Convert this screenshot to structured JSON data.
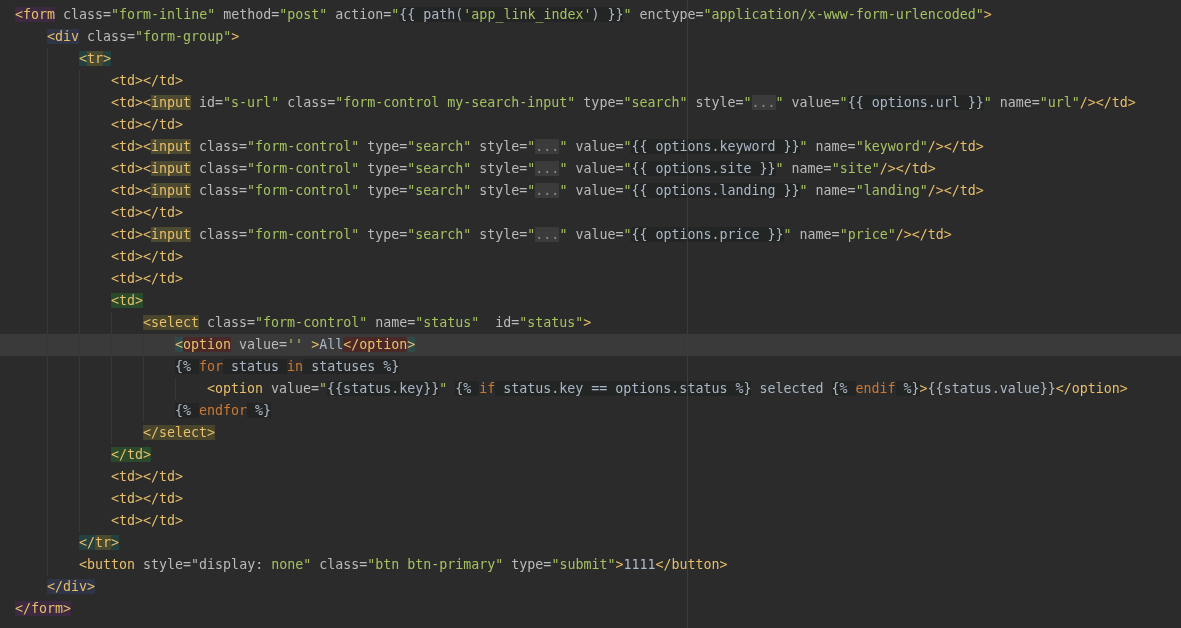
{
  "lines": [
    {
      "tokens": [
        {
          "text": "<form",
          "kind": "tag",
          "color": "#3d2a40"
        },
        {
          "text": " class=",
          "kind": "attr"
        },
        {
          "text": "\"form-inline\"",
          "kind": "str"
        },
        {
          "text": " method=",
          "kind": "attr"
        },
        {
          "text": "\"post\"",
          "kind": "str"
        },
        {
          "text": " action=",
          "kind": "attr"
        },
        {
          "text": "\"",
          "kind": "str"
        },
        {
          "text": "{{ path(",
          "kind": "tpl"
        },
        {
          "text": "'app_link_index'",
          "kind": "tplstr"
        },
        {
          "text": ") }}",
          "kind": "tpl"
        },
        {
          "text": "\"",
          "kind": "str"
        },
        {
          "text": " enctype=",
          "kind": "attr"
        },
        {
          "text": "\"application/x-www-form-urlencoded\"",
          "kind": "str"
        },
        {
          "text": ">",
          "kind": "tag"
        }
      ],
      "children": [
        {
          "tokens": [
            {
              "text": "<div",
              "kind": "tag",
              "color": "#2f3447"
            },
            {
              "text": " class=",
              "kind": "attr"
            },
            {
              "text": "\"form-group\"",
              "kind": "str"
            },
            {
              "text": ">",
              "kind": "tag"
            }
          ],
          "children": [
            {
              "tokens": [
                {
                  "text": "<",
                  "kind": "tag",
                  "color": "#24403f"
                },
                {
                  "text": "tr",
                  "kind": "tag",
                  "color": "#4a4a30"
                },
                {
                  "text": ">",
                  "kind": "tag",
                  "color": "#24403f"
                }
              ],
              "children": [
                {
                  "tokens": [
                    {
                      "text": "<td></td>",
                      "kind": "tag"
                    }
                  ]
                },
                {
                  "tokens": [
                    {
                      "text": "<td><",
                      "kind": "tag"
                    },
                    {
                      "text": "input",
                      "kind": "tag",
                      "color": "#4d4a32"
                    },
                    {
                      "text": " id=",
                      "kind": "attr"
                    },
                    {
                      "text": "\"s-url\"",
                      "kind": "str"
                    },
                    {
                      "text": " class=",
                      "kind": "attr"
                    },
                    {
                      "text": "\"form-control my-search-input\"",
                      "kind": "str"
                    },
                    {
                      "text": " type=",
                      "kind": "attr"
                    },
                    {
                      "text": "\"search\"",
                      "kind": "str"
                    },
                    {
                      "text": " style=",
                      "kind": "attr"
                    },
                    {
                      "text": "\"",
                      "kind": "str"
                    },
                    {
                      "text": "...",
                      "kind": "fold"
                    },
                    {
                      "text": "\"",
                      "kind": "str"
                    },
                    {
                      "text": " value=",
                      "kind": "attr"
                    },
                    {
                      "text": "\"",
                      "kind": "str"
                    },
                    {
                      "text": "{{ options.url }}",
                      "kind": "tpl"
                    },
                    {
                      "text": "\"",
                      "kind": "str"
                    },
                    {
                      "text": " name=",
                      "kind": "attr"
                    },
                    {
                      "text": "\"url\"",
                      "kind": "str"
                    },
                    {
                      "text": "/></td>",
                      "kind": "tag"
                    }
                  ]
                },
                {
                  "tokens": [
                    {
                      "text": "<td></td>",
                      "kind": "tag"
                    }
                  ]
                },
                {
                  "tokens": [
                    {
                      "text": "<td><",
                      "kind": "tag"
                    },
                    {
                      "text": "input",
                      "kind": "tag",
                      "color": "#4d4a32"
                    },
                    {
                      "text": " class=",
                      "kind": "attr"
                    },
                    {
                      "text": "\"form-control\"",
                      "kind": "str"
                    },
                    {
                      "text": " type=",
                      "kind": "attr"
                    },
                    {
                      "text": "\"search\"",
                      "kind": "str"
                    },
                    {
                      "text": " style=",
                      "kind": "attr"
                    },
                    {
                      "text": "\"",
                      "kind": "str"
                    },
                    {
                      "text": "...",
                      "kind": "fold"
                    },
                    {
                      "text": "\"",
                      "kind": "str"
                    },
                    {
                      "text": " value=",
                      "kind": "attr"
                    },
                    {
                      "text": "\"",
                      "kind": "str"
                    },
                    {
                      "text": "{{ options.keyword }}",
                      "kind": "tpl"
                    },
                    {
                      "text": "\"",
                      "kind": "str"
                    },
                    {
                      "text": " name=",
                      "kind": "attr"
                    },
                    {
                      "text": "\"keyword\"",
                      "kind": "str"
                    },
                    {
                      "text": "/></td>",
                      "kind": "tag"
                    }
                  ]
                },
                {
                  "tokens": [
                    {
                      "text": "<td><",
                      "kind": "tag"
                    },
                    {
                      "text": "input",
                      "kind": "tag",
                      "color": "#4d4a32"
                    },
                    {
                      "text": " class=",
                      "kind": "attr"
                    },
                    {
                      "text": "\"form-control\"",
                      "kind": "str"
                    },
                    {
                      "text": " type=",
                      "kind": "attr"
                    },
                    {
                      "text": "\"search\"",
                      "kind": "str"
                    },
                    {
                      "text": " style=",
                      "kind": "attr"
                    },
                    {
                      "text": "\"",
                      "kind": "str"
                    },
                    {
                      "text": "...",
                      "kind": "fold"
                    },
                    {
                      "text": "\"",
                      "kind": "str"
                    },
                    {
                      "text": " value=",
                      "kind": "attr"
                    },
                    {
                      "text": "\"",
                      "kind": "str"
                    },
                    {
                      "text": "{{ options.site }}",
                      "kind": "tpl"
                    },
                    {
                      "text": "\"",
                      "kind": "str"
                    },
                    {
                      "text": " name=",
                      "kind": "attr"
                    },
                    {
                      "text": "\"site\"",
                      "kind": "str"
                    },
                    {
                      "text": "/></td>",
                      "kind": "tag"
                    }
                  ]
                },
                {
                  "tokens": [
                    {
                      "text": "<td><",
                      "kind": "tag"
                    },
                    {
                      "text": "input",
                      "kind": "tag",
                      "color": "#4d4a32"
                    },
                    {
                      "text": " class=",
                      "kind": "attr"
                    },
                    {
                      "text": "\"form-control\"",
                      "kind": "str"
                    },
                    {
                      "text": " type=",
                      "kind": "attr"
                    },
                    {
                      "text": "\"search\"",
                      "kind": "str"
                    },
                    {
                      "text": " style=",
                      "kind": "attr"
                    },
                    {
                      "text": "\"",
                      "kind": "str"
                    },
                    {
                      "text": "...",
                      "kind": "fold"
                    },
                    {
                      "text": "\"",
                      "kind": "str"
                    },
                    {
                      "text": " value=",
                      "kind": "attr"
                    },
                    {
                      "text": "\"",
                      "kind": "str"
                    },
                    {
                      "text": "{{ options.landing }}",
                      "kind": "tpl"
                    },
                    {
                      "text": "\"",
                      "kind": "str"
                    },
                    {
                      "text": " name=",
                      "kind": "attr"
                    },
                    {
                      "text": "\"landing\"",
                      "kind": "str"
                    },
                    {
                      "text": "/></td>",
                      "kind": "tag"
                    }
                  ]
                },
                {
                  "tokens": [
                    {
                      "text": "<td></td>",
                      "kind": "tag"
                    }
                  ]
                },
                {
                  "tokens": [
                    {
                      "text": "<td><",
                      "kind": "tag"
                    },
                    {
                      "text": "input",
                      "kind": "tag",
                      "color": "#4d4a32"
                    },
                    {
                      "text": " class=",
                      "kind": "attr"
                    },
                    {
                      "text": "\"form-control\"",
                      "kind": "str"
                    },
                    {
                      "text": " type=",
                      "kind": "attr"
                    },
                    {
                      "text": "\"search\"",
                      "kind": "str"
                    },
                    {
                      "text": " style=",
                      "kind": "attr"
                    },
                    {
                      "text": "\"",
                      "kind": "str"
                    },
                    {
                      "text": "...",
                      "kind": "fold"
                    },
                    {
                      "text": "\"",
                      "kind": "str"
                    },
                    {
                      "text": " value=",
                      "kind": "attr"
                    },
                    {
                      "text": "\"",
                      "kind": "str"
                    },
                    {
                      "text": "{{ options.price }}",
                      "kind": "tpl"
                    },
                    {
                      "text": "\"",
                      "kind": "str"
                    },
                    {
                      "text": " name=",
                      "kind": "attr"
                    },
                    {
                      "text": "\"price\"",
                      "kind": "str"
                    },
                    {
                      "text": "/></td>",
                      "kind": "tag"
                    }
                  ]
                },
                {
                  "tokens": [
                    {
                      "text": "<td></td>",
                      "kind": "tag"
                    }
                  ]
                },
                {
                  "tokens": [
                    {
                      "text": "<td></td>",
                      "kind": "tag"
                    }
                  ]
                },
                {
                  "tokens": [
                    {
                      "text": "<td>",
                      "kind": "tag",
                      "color": "#2b4a2b"
                    }
                  ],
                  "children": [
                    {
                      "tokens": [
                        {
                          "text": "<select",
                          "kind": "tag",
                          "color": "#48452c"
                        },
                        {
                          "text": " class=",
                          "kind": "attr"
                        },
                        {
                          "text": "\"form-control\"",
                          "kind": "str"
                        },
                        {
                          "text": " name=",
                          "kind": "attr"
                        },
                        {
                          "text": "\"status\"",
                          "kind": "str"
                        },
                        {
                          "text": "  id=",
                          "kind": "attr"
                        },
                        {
                          "text": "\"status\"",
                          "kind": "str"
                        },
                        {
                          "text": ">",
                          "kind": "tag"
                        }
                      ],
                      "children": [
                        {
                          "current": true,
                          "tokens": [
                            {
                              "text": "<",
                              "kind": "tag",
                              "color": "#2f4a48"
                            },
                            {
                              "text": "option",
                              "kind": "tag",
                              "color": "#4a2828"
                            },
                            {
                              "text": " value=",
                              "kind": "attr"
                            },
                            {
                              "text": "''",
                              "kind": "str"
                            },
                            {
                              "text": " >",
                              "kind": "tag"
                            },
                            {
                              "text": "All",
                              "kind": "text"
                            },
                            {
                              "text": "</option",
                              "kind": "tag",
                              "color": "#4a2828"
                            },
                            {
                              "text": ">",
                              "kind": "tag",
                              "color": "#2f4a48"
                            }
                          ]
                        },
                        {
                          "tokens": [
                            {
                              "text": "{% ",
                              "kind": "tpl"
                            },
                            {
                              "text": "for",
                              "kind": "kw"
                            },
                            {
                              "text": " status ",
                              "kind": "tpl"
                            },
                            {
                              "text": "in",
                              "kind": "kw"
                            },
                            {
                              "text": " statuses %}",
                              "kind": "tpl"
                            }
                          ],
                          "children": [
                            {
                              "tokens": [
                                {
                                  "text": "<option",
                                  "kind": "tag"
                                },
                                {
                                  "text": " value=",
                                  "kind": "attr"
                                },
                                {
                                  "text": "\"",
                                  "kind": "str"
                                },
                                {
                                  "text": "{{status.key}}",
                                  "kind": "tpl"
                                },
                                {
                                  "text": "\" ",
                                  "kind": "str"
                                },
                                {
                                  "text": "{% ",
                                  "kind": "tpl"
                                },
                                {
                                  "text": "if",
                                  "kind": "kw"
                                },
                                {
                                  "text": " status.key == options.status %}",
                                  "kind": "tpl"
                                },
                                {
                                  "text": " selected ",
                                  "kind": "text"
                                },
                                {
                                  "text": "{% ",
                                  "kind": "tpl"
                                },
                                {
                                  "text": "endif",
                                  "kind": "kw"
                                },
                                {
                                  "text": " %}",
                                  "kind": "tpl"
                                },
                                {
                                  "text": ">",
                                  "kind": "tag"
                                },
                                {
                                  "text": "{{status.value}}",
                                  "kind": "text"
                                },
                                {
                                  "text": "</option>",
                                  "kind": "tag"
                                }
                              ]
                            }
                          ]
                        },
                        {
                          "tokens": [
                            {
                              "text": "{% ",
                              "kind": "tpl"
                            },
                            {
                              "text": "endfor",
                              "kind": "kw"
                            },
                            {
                              "text": " %}",
                              "kind": "tpl"
                            }
                          ]
                        }
                      ]
                    },
                    {
                      "tokens": [
                        {
                          "text": "</select>",
                          "kind": "tag",
                          "color": "#48452c"
                        }
                      ]
                    }
                  ]
                },
                {
                  "tokens": [
                    {
                      "text": "</td>",
                      "kind": "tag",
                      "color": "#2b4a2b"
                    }
                  ]
                },
                {
                  "tokens": [
                    {
                      "text": "<td></td>",
                      "kind": "tag"
                    }
                  ]
                },
                {
                  "tokens": [
                    {
                      "text": "<td></td>",
                      "kind": "tag"
                    }
                  ]
                },
                {
                  "tokens": [
                    {
                      "text": "<td></td>",
                      "kind": "tag"
                    }
                  ]
                }
              ]
            },
            {
              "tokens": [
                {
                  "text": "</",
                  "kind": "tag",
                  "color": "#24403f"
                },
                {
                  "text": "tr",
                  "kind": "tag",
                  "color": "#4a4a30"
                },
                {
                  "text": ">",
                  "kind": "tag",
                  "color": "#24403f"
                }
              ]
            },
            {
              "tokens": [
                {
                  "text": "<button",
                  "kind": "tag"
                },
                {
                  "text": " style=",
                  "kind": "attr"
                },
                {
                  "text": "\"display: ",
                  "kind": "attr"
                },
                {
                  "text": "none\"",
                  "kind": "str"
                },
                {
                  "text": " class=",
                  "kind": "attr"
                },
                {
                  "text": "\"btn btn-primary\"",
                  "kind": "str"
                },
                {
                  "text": " type=",
                  "kind": "attr"
                },
                {
                  "text": "\"submit\"",
                  "kind": "str"
                },
                {
                  "text": ">",
                  "kind": "tag"
                },
                {
                  "text": "1111",
                  "kind": "text"
                },
                {
                  "text": "</button>",
                  "kind": "tag"
                }
              ]
            }
          ]
        },
        {
          "tokens": [
            {
              "text": "</div>",
              "kind": "tag",
              "color": "#2f3447"
            }
          ]
        }
      ]
    },
    {
      "tokens": [
        {
          "text": "</form>",
          "kind": "tag",
          "color": "#3d2a40"
        }
      ]
    }
  ]
}
